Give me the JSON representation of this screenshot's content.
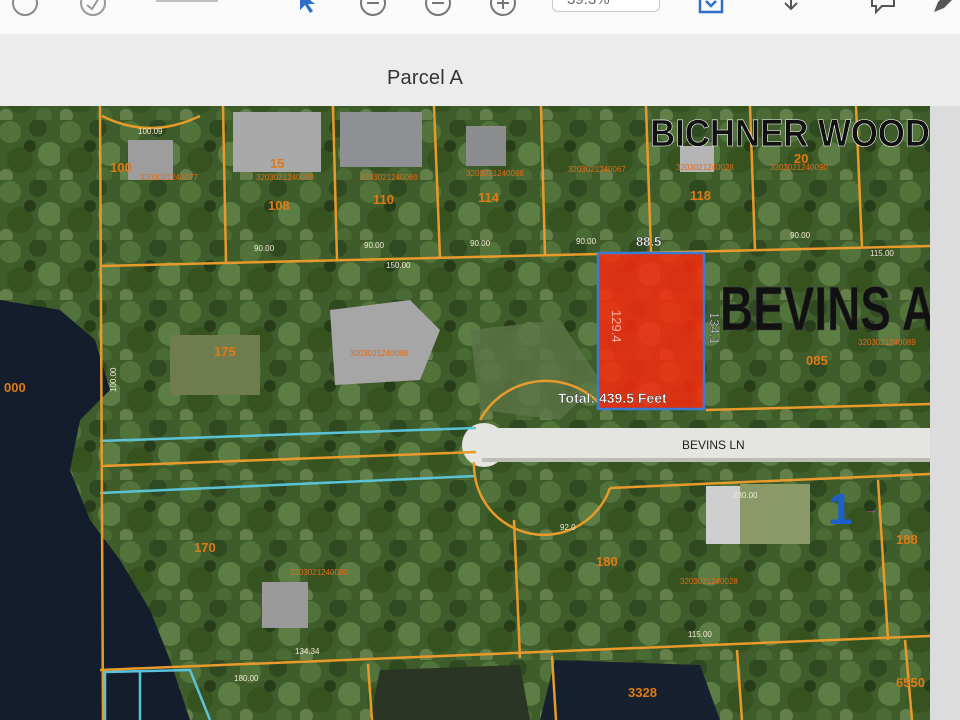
{
  "toolbar": {
    "zoom_value": "39.3%",
    "icons": [
      "info-icon",
      "stamp-icon",
      "page-counter",
      "pointer-icon",
      "zoom-out-icon",
      "zoom-minus-icon",
      "zoom-plus-icon",
      "fit-page-icon",
      "download-icon",
      "comment-icon",
      "pen-icon"
    ]
  },
  "document": {
    "title": "Parcel A"
  },
  "map": {
    "subdivision_label": "BICHNER WOOD",
    "addition_label": "BEVINS A",
    "street_label": "BEVINS LN",
    "parcel_numbers": [
      "100",
      "15",
      "108",
      "110",
      "114",
      "118",
      "20",
      "175",
      "085",
      "000",
      "170",
      "180",
      "188",
      "3328",
      "6550"
    ],
    "parcel_ids": [
      "3203021240077",
      "3203021240070",
      "3203021240069",
      "3203021240068",
      "3203021240067",
      "3203021240028",
      "3203021240090",
      "3203021240088",
      "3203021240089",
      "3203021240090",
      "3203021240028"
    ],
    "dimensions": [
      "100.09",
      "90.00",
      "90.00",
      "90.00",
      "90.00",
      "88.5",
      "90.00",
      "115.00",
      "150.00",
      "100.00",
      "230.00",
      "115.00",
      "134.34",
      "180.00",
      "92.0"
    ],
    "measurement": {
      "top_length": "88.5",
      "left_length": "129.4",
      "right_length": "134.1",
      "total_label": "Total: 439.5 Feet",
      "highlight_color": "#ff2a10",
      "outline_color": "#3a7bd5"
    },
    "marker_label": "1",
    "colors": {
      "lot_line": "#e89a2a",
      "easement_line": "#5bc3d8",
      "label": "#e07a16",
      "water": "#141d2c"
    }
  }
}
